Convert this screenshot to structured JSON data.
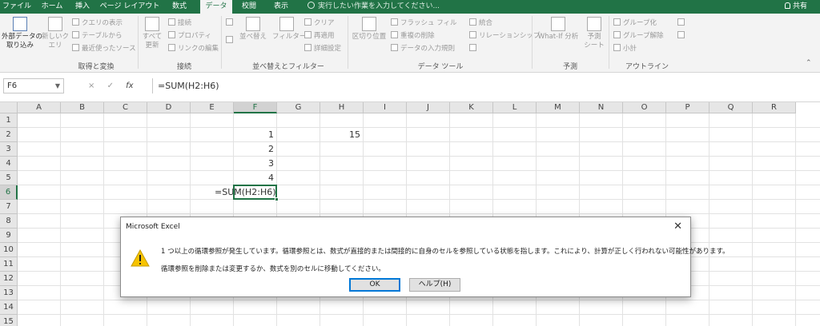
{
  "tabs": [
    "ファイル",
    "ホーム",
    "挿入",
    "ページ レイアウト",
    "数式",
    "データ",
    "校閲",
    "表示"
  ],
  "tellme": "実行したい作業を入力してください...",
  "share": "共有",
  "ribbon": {
    "external_data": "外部データの",
    "external_data2": "取り込み",
    "new_query": "新しいク",
    "new_query2": "エリ",
    "show_queries": "クエリの表示",
    "from_table": "テーブルから",
    "recent_sources": "最近使ったソース",
    "group_get_transform": "取得と変換",
    "refresh_all": "すべて",
    "refresh_all2": "更新",
    "connections": "接続",
    "properties": "プロパティ",
    "edit_links": "リンクの編集",
    "group_connections": "接続",
    "sort": "並べ替え",
    "filter": "フィルター",
    "clear": "クリア",
    "reapply": "再適用",
    "advanced": "詳細設定",
    "group_sort_filter": "並べ替えとフィルター",
    "text_to_columns": "区切り位置",
    "flash_fill": "フラッシュ フィル",
    "remove_duplicates": "重複の削除",
    "data_validation": "データの入力規則",
    "consolidate": "統合",
    "relationships": "リレーションシップ",
    "group_data_tools": "データ ツール",
    "what_if": "What-If 分析",
    "forecast_sheet": "予測",
    "forecast_sheet2": "シート",
    "group_forecast": "予測",
    "group_outline_btn": "グループ化",
    "ungroup": "グループ解除",
    "subtotal": "小計",
    "group_outline": "アウトライン"
  },
  "namebox": "F6",
  "formula_bar": "=SUM(H2:H6)",
  "formula_icons": {
    "cancel": "×",
    "enter": "✓",
    "fx": "fx"
  },
  "columns": [
    "A",
    "B",
    "C",
    "D",
    "E",
    "F",
    "G",
    "H",
    "I",
    "J",
    "K",
    "L",
    "M",
    "N",
    "O",
    "P",
    "Q",
    "R"
  ],
  "rows": [
    "1",
    "2",
    "3",
    "4",
    "5",
    "6",
    "7",
    "8",
    "9",
    "10",
    "11",
    "12",
    "13",
    "14",
    "15"
  ],
  "cells": {
    "F2": "1",
    "F3": "2",
    "F4": "3",
    "F5": "4",
    "F6": "=SUM(H2:H6)",
    "H2": "15"
  },
  "dialog": {
    "title": "Microsoft Excel",
    "close": "✕",
    "message1": "1 つ以上の循環参照が発生しています。循環参照とは、数式が直接的または間接的に自身のセルを参照している状態を指します。これにより、計算が正しく行われない可能性があります。",
    "message2": "循環参照を削除または変更するか、数式を別のセルに移動してください。",
    "ok": "OK",
    "help": "ヘルプ(H)"
  },
  "colors": {
    "accent": "#217346",
    "warning": "#f7c300",
    "dialog_default_border": "#0078d7"
  }
}
